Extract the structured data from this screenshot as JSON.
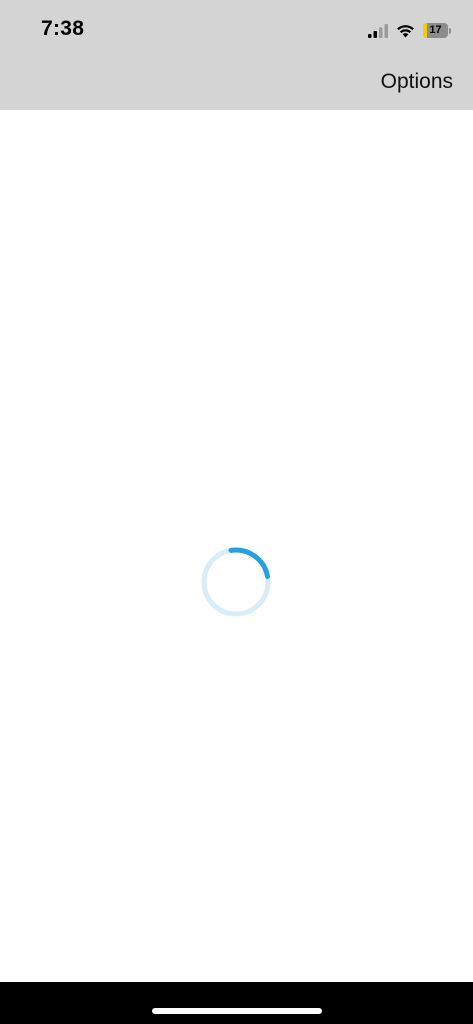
{
  "status_bar": {
    "time": "7:38",
    "signal_icon": "cellular-signal-icon",
    "wifi_icon": "wifi-icon",
    "battery_icon": "battery-charging-icon",
    "battery_level": "17",
    "battery_percent": 17,
    "battery_color": "#f5cc00"
  },
  "nav_bar": {
    "options_label": "Options"
  },
  "content": {
    "loading_indicator": "loading-spinner-icon",
    "accent_color": "#2a9fe0",
    "track_color": "#d9ecfa"
  }
}
